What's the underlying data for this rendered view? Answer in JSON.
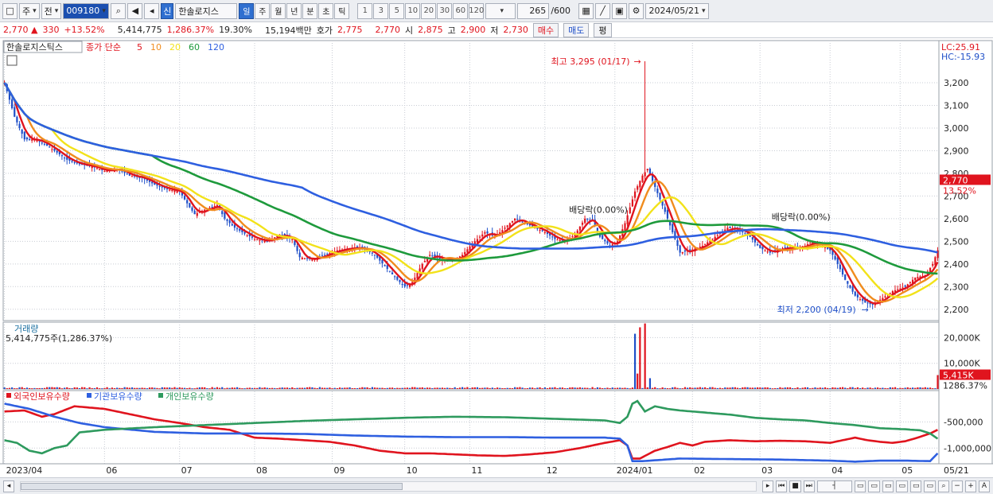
{
  "toolbar": {
    "market": "주",
    "scope": "전",
    "code": "009180",
    "badge": "신",
    "name": "한솔로지스",
    "periods": [
      "일",
      "주",
      "월",
      "년",
      "분",
      "초",
      "틱"
    ],
    "active_period": "일",
    "intervals": [
      "1",
      "3",
      "5",
      "10",
      "20",
      "30",
      "60",
      "120"
    ],
    "count": "265",
    "count_max": "/600",
    "date": "2024/05/21"
  },
  "quote": {
    "price": "2,770",
    "change": "330",
    "change_pct": "+13.52%",
    "volume": "5,414,775",
    "volume_pct": "1,286.37%",
    "turnover": "19.30%",
    "amount": "15,194백만",
    "bid_label": "호가",
    "bid1": "2,775",
    "bid2": "2,770",
    "open_label": "시",
    "open": "2,875",
    "high_label": "고",
    "high": "2,900",
    "low_label": "저",
    "low": "2,730",
    "buy": "매수",
    "sell": "매도",
    "eval": "평"
  },
  "colors": {
    "up": "#e0141e",
    "down": "#1f4fc8",
    "ma5": "#e0141e",
    "ma10": "#f08c1e",
    "ma20": "#f2e21a",
    "ma60": "#1e9a3c",
    "ma120": "#2e5fe0",
    "foreign": "#e0141e",
    "inst": "#2e5fe0",
    "indiv": "#2e9a5e",
    "price_tag": "#e0141e"
  },
  "chart_data": [
    {
      "type": "line",
      "title": "한솔로지스틱스",
      "legend": {
        "base": "종가 단순",
        "periods": [
          "5",
          "10",
          "20",
          "60",
          "120"
        ]
      },
      "lc": "LC:25.91",
      "hc": "HC:-15.93",
      "yticks": [
        3200,
        3100,
        3000,
        2900,
        2800,
        2700,
        2600,
        2500,
        2400,
        2300,
        2200
      ],
      "ylim": [
        2150,
        3330
      ],
      "ytick_labels": [
        "3,200",
        "3,100",
        "3,000",
        "2,900",
        "2,800",
        "2,700",
        "2,600",
        "2,500",
        "2,400",
        "2,300",
        "2,200"
      ],
      "x_labels": [
        {
          "label": "2023/04",
          "i": 0
        },
        {
          "label": "06",
          "i": 40
        },
        {
          "label": "07",
          "i": 70
        },
        {
          "label": "08",
          "i": 100
        },
        {
          "label": "09",
          "i": 131
        },
        {
          "label": "10",
          "i": 160
        },
        {
          "label": "11",
          "i": 186
        },
        {
          "label": "12",
          "i": 216
        },
        {
          "label": "2024/01",
          "i": 244
        },
        {
          "label": "02",
          "i": 275
        },
        {
          "label": "03",
          "i": 302
        },
        {
          "label": "04",
          "i": 330
        },
        {
          "label": "05",
          "i": 358
        },
        {
          "label": "05/21",
          "i": 384
        }
      ],
      "anchors": [
        [
          0,
          3200
        ],
        [
          4,
          3050
        ],
        [
          8,
          2950
        ],
        [
          12,
          2950
        ],
        [
          16,
          2930
        ],
        [
          20,
          2900
        ],
        [
          25,
          2860
        ],
        [
          30,
          2840
        ],
        [
          35,
          2830
        ],
        [
          40,
          2810
        ],
        [
          45,
          2820
        ],
        [
          50,
          2790
        ],
        [
          55,
          2780
        ],
        [
          60,
          2750
        ],
        [
          65,
          2730
        ],
        [
          70,
          2720
        ],
        [
          74,
          2650
        ],
        [
          76,
          2620
        ],
        [
          80,
          2640
        ],
        [
          85,
          2660
        ],
        [
          88,
          2600
        ],
        [
          92,
          2560
        ],
        [
          95,
          2540
        ],
        [
          100,
          2510
        ],
        [
          105,
          2500
        ],
        [
          110,
          2530
        ],
        [
          115,
          2510
        ],
        [
          118,
          2430
        ],
        [
          123,
          2420
        ],
        [
          128,
          2440
        ],
        [
          133,
          2460
        ],
        [
          138,
          2470
        ],
        [
          143,
          2470
        ],
        [
          148,
          2440
        ],
        [
          152,
          2390
        ],
        [
          157,
          2330
        ],
        [
          160,
          2300
        ],
        [
          163,
          2320
        ],
        [
          167,
          2400
        ],
        [
          170,
          2440
        ],
        [
          175,
          2420
        ],
        [
          180,
          2420
        ],
        [
          183,
          2440
        ],
        [
          187,
          2490
        ],
        [
          192,
          2540
        ],
        [
          196,
          2520
        ],
        [
          200,
          2560
        ],
        [
          204,
          2600
        ],
        [
          208,
          2580
        ],
        [
          212,
          2560
        ],
        [
          216,
          2540
        ],
        [
          220,
          2510
        ],
        [
          224,
          2500
        ],
        [
          228,
          2530
        ],
        [
          232,
          2600
        ],
        [
          235,
          2590
        ],
        [
          238,
          2520
        ],
        [
          242,
          2480
        ],
        [
          245,
          2500
        ],
        [
          248,
          2580
        ],
        [
          252,
          2720
        ],
        [
          255,
          2790
        ],
        [
          257,
          2820
        ],
        [
          260,
          2740
        ],
        [
          264,
          2630
        ],
        [
          267,
          2540
        ],
        [
          270,
          2450
        ],
        [
          274,
          2460
        ],
        [
          279,
          2480
        ],
        [
          284,
          2520
        ],
        [
          289,
          2560
        ],
        [
          294,
          2550
        ],
        [
          298,
          2520
        ],
        [
          302,
          2470
        ],
        [
          306,
          2450
        ],
        [
          311,
          2470
        ],
        [
          316,
          2470
        ],
        [
          320,
          2480
        ],
        [
          323,
          2500
        ],
        [
          327,
          2480
        ],
        [
          330,
          2460
        ],
        [
          333,
          2400
        ],
        [
          336,
          2330
        ],
        [
          340,
          2260
        ],
        [
          344,
          2230
        ],
        [
          347,
          2220
        ],
        [
          351,
          2250
        ],
        [
          355,
          2280
        ],
        [
          360,
          2300
        ],
        [
          364,
          2340
        ],
        [
          368,
          2350
        ],
        [
          371,
          2400
        ],
        [
          373,
          2460
        ]
      ],
      "n_days": 374,
      "ma": [
        {
          "name": "5",
          "period": 5
        },
        {
          "name": "10",
          "period": 10
        },
        {
          "name": "20",
          "period": 20
        },
        {
          "name": "60",
          "period": 60
        },
        {
          "name": "120",
          "period": 120
        }
      ],
      "dividend_annotations": [
        {
          "label": "배당락(0.00%)",
          "i": 239
        },
        {
          "label": "배당락(0.00%)",
          "i": 320
        }
      ],
      "high_annotation": {
        "label": "최고 3,295 (01/17)",
        "i": 256,
        "value": 3295
      },
      "low_annotation": {
        "label": "최저 2,200 (04/19)",
        "i": 347,
        "value": 2200
      },
      "last_price": {
        "label": "2,770",
        "pct": "13.52%",
        "value": 2770
      }
    },
    {
      "type": "bar",
      "title": "거래량",
      "subtitle": "5,414,775주(1,286.37%)",
      "yticks": [
        20000,
        10000
      ],
      "ytick_labels": [
        "20,000K",
        "10,000K"
      ],
      "ylim": [
        0,
        26000
      ],
      "spikes": [
        {
          "i": 252,
          "value": 21500
        },
        {
          "i": 254,
          "value": 24000
        },
        {
          "i": 256,
          "value": 25500
        },
        {
          "i": 258,
          "value": 4200
        },
        {
          "i": 253,
          "value": 6000
        },
        {
          "i": 373,
          "value": 5415
        }
      ],
      "last": {
        "label": "5,415K",
        "pct": "1286.37%"
      }
    },
    {
      "type": "line",
      "legend": [
        "외국인보유수량",
        "기관보유수량",
        "개인보유수량"
      ],
      "yticks": [
        -500000,
        -1000000
      ],
      "ytick_labels": [
        "-500,000",
        "-1,000,000"
      ],
      "ylim": [
        -1300000,
        100000
      ],
      "series": [
        {
          "name": "외국인보유수량",
          "anchors": [
            [
              0,
              -300000
            ],
            [
              8,
              -280000
            ],
            [
              15,
              -400000
            ],
            [
              20,
              -350000
            ],
            [
              28,
              -200000
            ],
            [
              40,
              -250000
            ],
            [
              50,
              -350000
            ],
            [
              60,
              -450000
            ],
            [
              70,
              -520000
            ],
            [
              80,
              -600000
            ],
            [
              90,
              -650000
            ],
            [
              100,
              -800000
            ],
            [
              110,
              -820000
            ],
            [
              120,
              -850000
            ],
            [
              130,
              -880000
            ],
            [
              140,
              -950000
            ],
            [
              150,
              -1050000
            ],
            [
              160,
              -1100000
            ],
            [
              170,
              -1100000
            ],
            [
              180,
              -1120000
            ],
            [
              190,
              -1140000
            ],
            [
              200,
              -1150000
            ],
            [
              210,
              -1120000
            ],
            [
              220,
              -1080000
            ],
            [
              230,
              -1000000
            ],
            [
              240,
              -900000
            ],
            [
              246,
              -850000
            ],
            [
              249,
              -950000
            ],
            [
              251,
              -1200000
            ],
            [
              254,
              -1200000
            ],
            [
              256,
              -1150000
            ],
            [
              260,
              -1050000
            ],
            [
              265,
              -980000
            ],
            [
              270,
              -900000
            ],
            [
              275,
              -950000
            ],
            [
              280,
              -880000
            ],
            [
              290,
              -850000
            ],
            [
              300,
              -870000
            ],
            [
              310,
              -860000
            ],
            [
              320,
              -870000
            ],
            [
              330,
              -900000
            ],
            [
              335,
              -850000
            ],
            [
              340,
              -800000
            ],
            [
              345,
              -850000
            ],
            [
              350,
              -880000
            ],
            [
              355,
              -900000
            ],
            [
              360,
              -870000
            ],
            [
              365,
              -800000
            ],
            [
              370,
              -720000
            ],
            [
              373,
              -650000
            ]
          ]
        },
        {
          "name": "기관보유수량",
          "anchors": [
            [
              0,
              -150000
            ],
            [
              10,
              -250000
            ],
            [
              20,
              -400000
            ],
            [
              30,
              -520000
            ],
            [
              40,
              -600000
            ],
            [
              60,
              -690000
            ],
            [
              80,
              -720000
            ],
            [
              100,
              -720000
            ],
            [
              120,
              -730000
            ],
            [
              140,
              -760000
            ],
            [
              160,
              -780000
            ],
            [
              180,
              -790000
            ],
            [
              200,
              -790000
            ],
            [
              220,
              -800000
            ],
            [
              240,
              -800000
            ],
            [
              246,
              -820000
            ],
            [
              249,
              -950000
            ],
            [
              251,
              -1250000
            ],
            [
              255,
              -1250000
            ],
            [
              270,
              -1200000
            ],
            [
              290,
              -1210000
            ],
            [
              310,
              -1220000
            ],
            [
              330,
              -1240000
            ],
            [
              340,
              -1260000
            ],
            [
              350,
              -1240000
            ],
            [
              360,
              -1240000
            ],
            [
              370,
              -1250000
            ],
            [
              373,
              -1100000
            ]
          ]
        },
        {
          "name": "개인보유수량",
          "anchors": [
            [
              0,
              -850000
            ],
            [
              5,
              -900000
            ],
            [
              10,
              -1050000
            ],
            [
              15,
              -1100000
            ],
            [
              20,
              -1000000
            ],
            [
              25,
              -950000
            ],
            [
              30,
              -700000
            ],
            [
              40,
              -650000
            ],
            [
              60,
              -600000
            ],
            [
              80,
              -560000
            ],
            [
              100,
              -520000
            ],
            [
              120,
              -480000
            ],
            [
              140,
              -450000
            ],
            [
              160,
              -420000
            ],
            [
              180,
              -400000
            ],
            [
              200,
              -410000
            ],
            [
              220,
              -440000
            ],
            [
              240,
              -470000
            ],
            [
              246,
              -520000
            ],
            [
              249,
              -400000
            ],
            [
              251,
              -150000
            ],
            [
              253,
              -100000
            ],
            [
              256,
              -300000
            ],
            [
              260,
              -200000
            ],
            [
              265,
              -250000
            ],
            [
              270,
              -280000
            ],
            [
              280,
              -320000
            ],
            [
              290,
              -360000
            ],
            [
              300,
              -420000
            ],
            [
              310,
              -450000
            ],
            [
              320,
              -470000
            ],
            [
              330,
              -520000
            ],
            [
              340,
              -560000
            ],
            [
              350,
              -620000
            ],
            [
              360,
              -640000
            ],
            [
              366,
              -660000
            ],
            [
              370,
              -720000
            ],
            [
              373,
              -820000
            ]
          ]
        }
      ]
    }
  ]
}
